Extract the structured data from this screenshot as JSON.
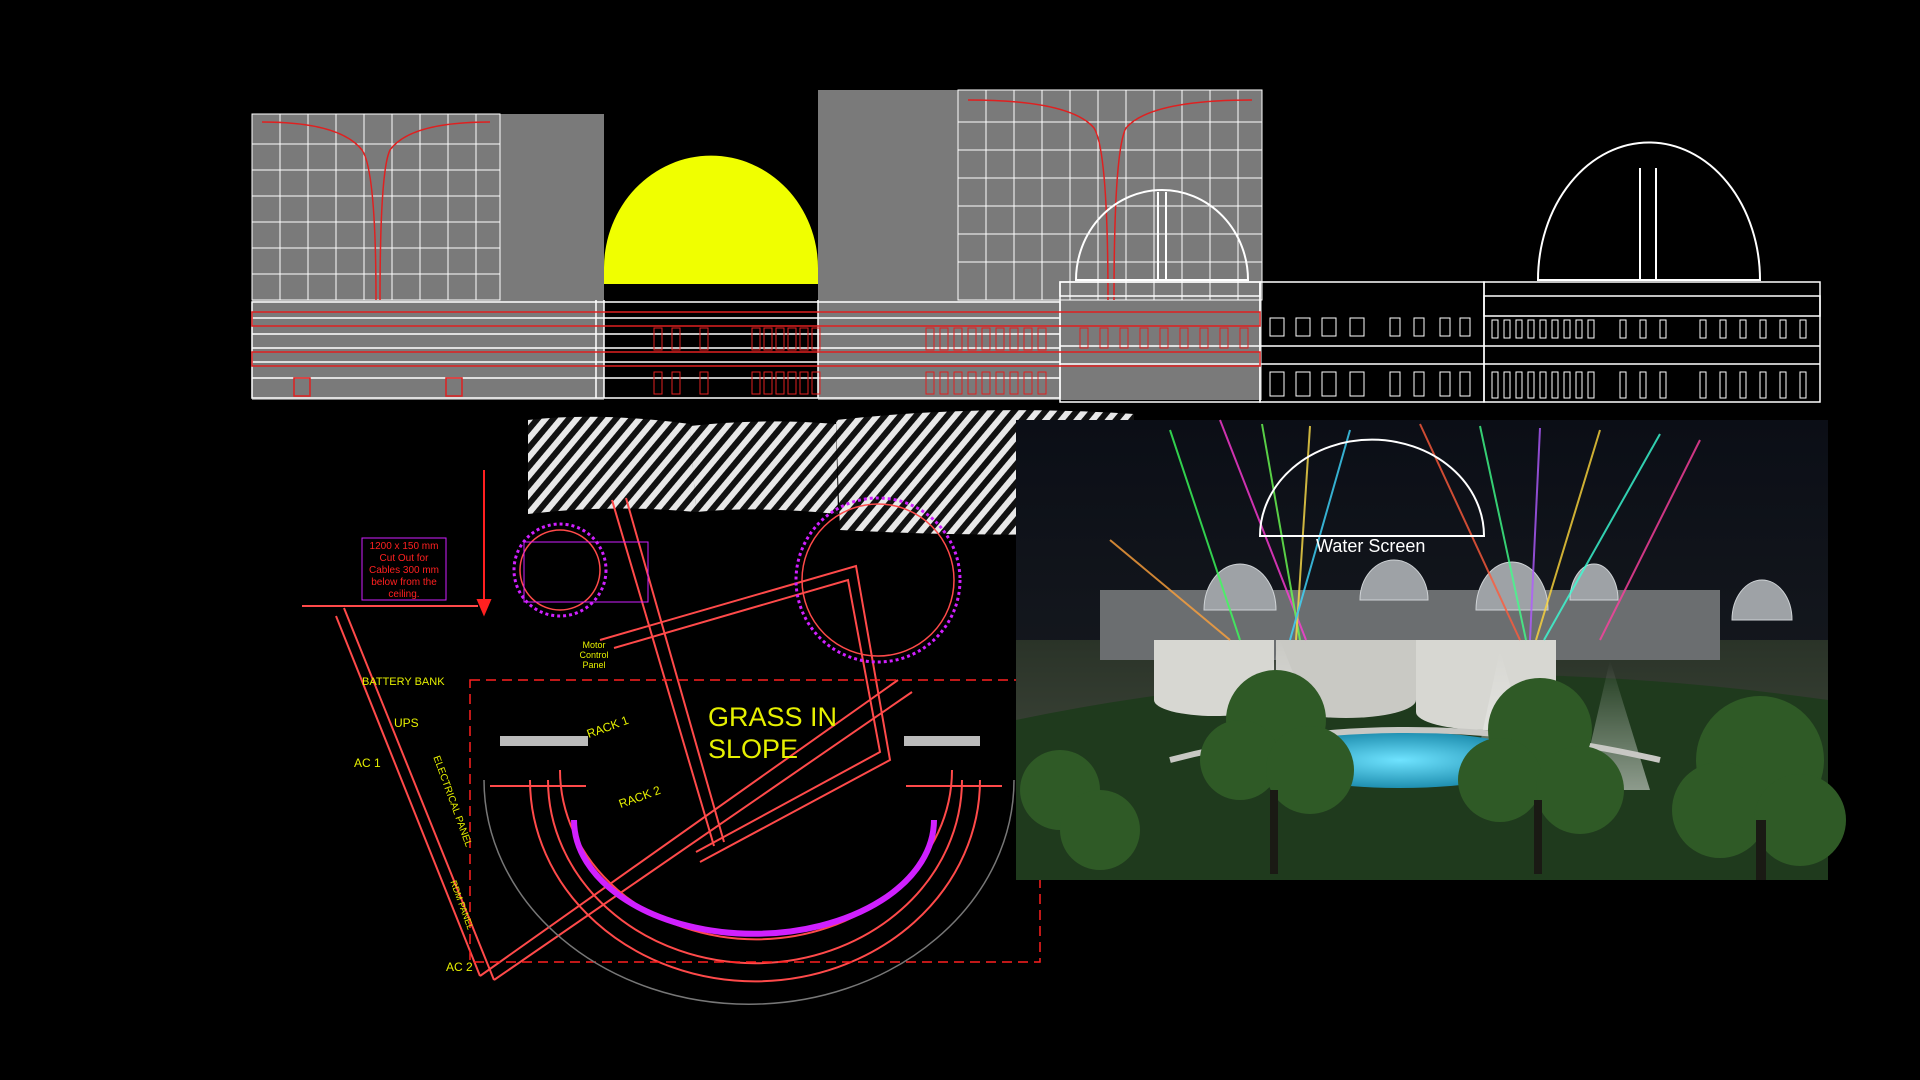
{
  "elevation": {
    "description_color_grey": "#7a7a7a",
    "dome_fill": "#f0ff00",
    "line_red": "#e02020",
    "line_white": "#ffffff"
  },
  "plan": {
    "cutout_note": "1200 x 150 mm Cut Out for Cables 300 mm below from the ceiling.",
    "grass_label_line1": "GRASS IN",
    "grass_label_line2": "SLOPE",
    "rack1": "RACK 1",
    "rack2": "RACK 2",
    "battery_bank": "BATTERY BANK",
    "ups": "UPS",
    "ac1": "AC 1",
    "ac2": "AC 2",
    "electrical_panel": "ELECTRICAL PANEL",
    "rdm_panel": "RDM PANEL",
    "motor_control_panel": "Motor Control Panel",
    "label_color": "#e6f000",
    "wall_color": "#ff4a4a",
    "accent_magenta": "#d020ff"
  },
  "render": {
    "water_screen_label": "Water Screen",
    "pool_color": "#2fb6d8"
  }
}
